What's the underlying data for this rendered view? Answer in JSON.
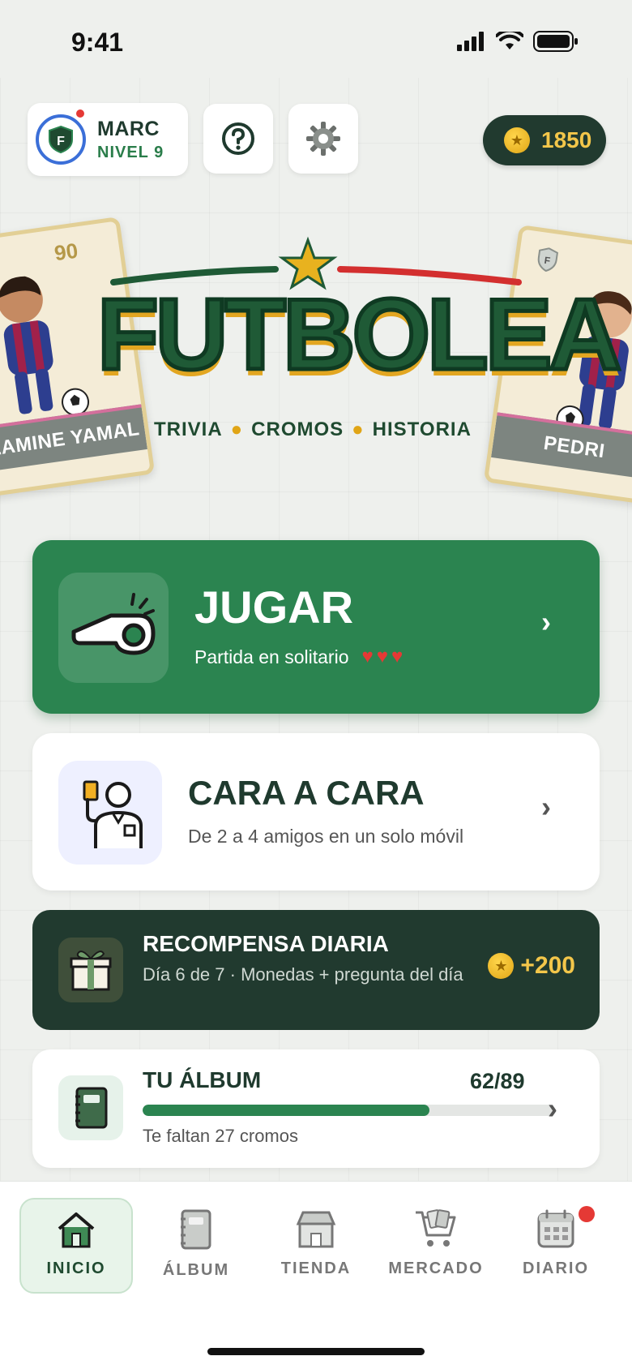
{
  "status_bar": {
    "time": "9:41"
  },
  "header": {
    "profile_name": "MARC",
    "profile_level": "NIVEL 9",
    "coins": "1850"
  },
  "hero": {
    "logo_text": "FUTBOLEA",
    "tagline": [
      "TRIVIA",
      "CROMOS",
      "HISTORIA"
    ],
    "card_left": {
      "rating": "90",
      "name": "LAMINE YAMAL"
    },
    "card_right": {
      "name": "PEDRI"
    }
  },
  "play": {
    "title": "JUGAR",
    "subtitle": "Partida en solitario",
    "lives": "♥♥♥"
  },
  "versus": {
    "title": "CARA A CARA",
    "subtitle": "De 2 a 4 amigos en un solo móvil"
  },
  "reward": {
    "title": "RECOMPENSA DIARIA",
    "subtitle": "Día 6 de 7 · Monedas + pregunta del día",
    "bonus": "+200"
  },
  "album": {
    "title": "TU ÁLBUM",
    "count": "62/89",
    "progress_fraction": 0.697,
    "subtitle": "Te faltan 27 cromos"
  },
  "nav": {
    "items": [
      {
        "label": "INICIO"
      },
      {
        "label": "ÁLBUM"
      },
      {
        "label": "TIENDA"
      },
      {
        "label": "MERCADO"
      },
      {
        "label": "DIARIO"
      }
    ]
  },
  "colors": {
    "brand_green": "#2b8450",
    "dark_green": "#213a2f",
    "gold": "#f3c64a",
    "alert_red": "#e53935"
  }
}
